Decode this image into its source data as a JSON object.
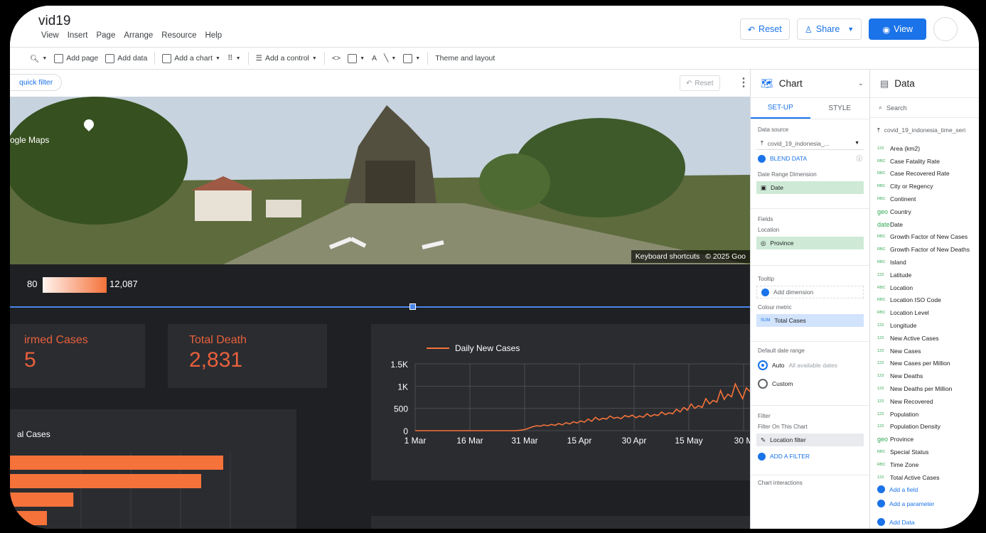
{
  "app": {
    "title": "vid19"
  },
  "menu": [
    "View",
    "Insert",
    "Page",
    "Arrange",
    "Resource",
    "Help"
  ],
  "header_actions": {
    "reset": "Reset",
    "share": "Share",
    "view": "View"
  },
  "toolbar": {
    "add_page": "Add page",
    "add_data": "Add data",
    "add_chart": "Add a chart",
    "add_control": "Add a control",
    "theme": "Theme and layout"
  },
  "canvas": {
    "quick_filter": "quick filter",
    "reset": "Reset"
  },
  "map": {
    "gmaps": "ogle Maps",
    "keyboard": "Keyboard shortcuts",
    "copyright": "© 2025 Goo"
  },
  "legend": {
    "min": "80",
    "max": "12,087"
  },
  "kpis": [
    {
      "label": "irmed Cases",
      "value": "5"
    },
    {
      "label": "Total Death",
      "value": "2,831"
    }
  ],
  "bar_card": {
    "title": "al Cases"
  },
  "chart_data": {
    "type": "line",
    "series": [
      {
        "name": "Daily New Cases",
        "color": "#f5723a"
      }
    ],
    "x_ticks": [
      "1 Mar",
      "16 Mar",
      "31 Mar",
      "15 Apr",
      "30 Apr",
      "15 May",
      "30 M"
    ],
    "y_ticks": [
      "0",
      "500",
      "1K",
      "1.5K"
    ],
    "ylim": [
      0,
      1500
    ],
    "values": [
      0,
      0,
      0,
      0,
      0,
      0,
      0,
      0,
      0,
      0,
      0,
      0,
      0,
      0,
      0,
      0,
      0,
      0,
      0,
      0,
      0,
      0,
      0,
      0,
      0,
      0,
      0,
      0,
      5,
      15,
      30,
      60,
      90,
      110,
      100,
      130,
      110,
      140,
      120,
      160,
      130,
      180,
      150,
      200,
      170,
      220,
      190,
      260,
      210,
      300,
      240,
      280,
      260,
      330,
      280,
      300,
      270,
      340,
      310,
      350,
      290,
      330,
      300,
      380,
      320,
      360,
      340,
      420,
      360,
      400,
      380,
      480,
      420,
      520,
      460,
      600,
      500,
      560,
      520,
      720,
      600,
      680,
      640,
      900,
      700,
      820,
      760,
      1050,
      880,
      720,
      960,
      880
    ]
  },
  "bars": [
    {
      "value": 100
    },
    {
      "value": 90
    },
    {
      "value": 32
    },
    {
      "value": 20
    },
    {
      "value": 12
    }
  ],
  "chart_panel": {
    "title": "Chart",
    "tabs": [
      "SET-UP",
      "STYLE"
    ],
    "data_source_label": "Data source",
    "data_source": "covid_19_indonesia_...",
    "blend": "BLEND DATA",
    "date_range_label": "Date Range Dimension",
    "date_field": "Date",
    "fields_label": "Fields",
    "location_label": "Location",
    "location_field": "Province",
    "tooltip_label": "Tooltip",
    "add_dimension": "Add dimension",
    "colour_label": "Colour metric",
    "colour_field": "Total Cases",
    "colour_badge": "SUM",
    "date_range_default_label": "Default date range",
    "auto": "Auto",
    "auto_desc": "All available dates",
    "custom": "Custom",
    "filter_label": "Filter",
    "filter_on_chart": "Filter On This Chart",
    "location_filter": "Location filter",
    "add_filter": "ADD A FILTER",
    "interactions": "Chart interactions"
  },
  "data_panel": {
    "title": "Data",
    "search": "Search",
    "source": "covid_19_indonesia_time_seri",
    "fields": [
      {
        "name": "Area (km2)",
        "type": "123"
      },
      {
        "name": "Case Fatality Rate",
        "type": "RBC"
      },
      {
        "name": "Case Recovered Rate",
        "type": "RBC"
      },
      {
        "name": "City or Regency",
        "type": "RBC"
      },
      {
        "name": "Continent",
        "type": "RBC"
      },
      {
        "name": "Country",
        "type": "geo"
      },
      {
        "name": "Date",
        "type": "date"
      },
      {
        "name": "Growth Factor of New Cases",
        "type": "RBC"
      },
      {
        "name": "Growth Factor of New Deaths",
        "type": "RBC"
      },
      {
        "name": "Island",
        "type": "RBC"
      },
      {
        "name": "Latitude",
        "type": "123"
      },
      {
        "name": "Location",
        "type": "RBC"
      },
      {
        "name": "Location ISO Code",
        "type": "RBC"
      },
      {
        "name": "Location Level",
        "type": "RBC"
      },
      {
        "name": "Longitude",
        "type": "123"
      },
      {
        "name": "New Active Cases",
        "type": "123"
      },
      {
        "name": "New Cases",
        "type": "123"
      },
      {
        "name": "New Cases per Million",
        "type": "123"
      },
      {
        "name": "New Deaths",
        "type": "123"
      },
      {
        "name": "New Deaths per Million",
        "type": "123"
      },
      {
        "name": "New Recovered",
        "type": "123"
      },
      {
        "name": "Population",
        "type": "123"
      },
      {
        "name": "Population Density",
        "type": "123"
      },
      {
        "name": "Province",
        "type": "geo"
      },
      {
        "name": "Special Status",
        "type": "RBC"
      },
      {
        "name": "Time Zone",
        "type": "RBC"
      },
      {
        "name": "Total Active Cases",
        "type": "123"
      }
    ],
    "add_field": "Add a field",
    "add_parameter": "Add a parameter",
    "add_data": "Add Data"
  }
}
